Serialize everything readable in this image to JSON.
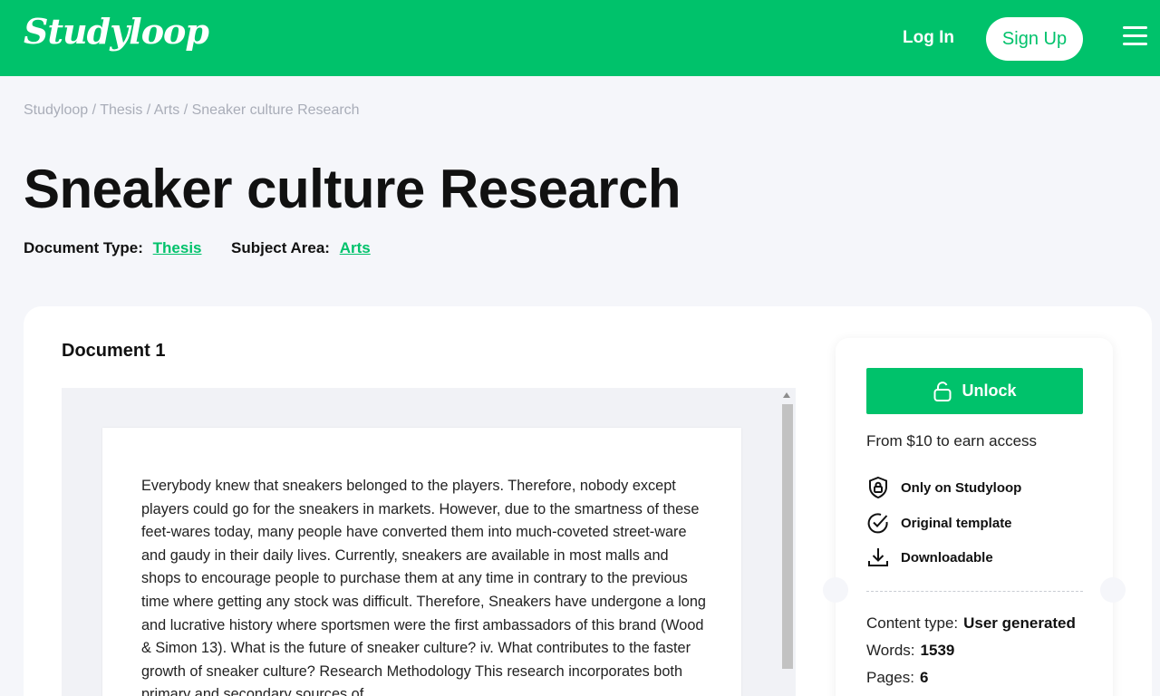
{
  "header": {
    "logo": "Studyloop",
    "login": "Log In",
    "signup": "Sign Up"
  },
  "breadcrumb": [
    "Studyloop",
    "Thesis",
    "Arts",
    "Sneaker culture Research"
  ],
  "title": "Sneaker culture Research",
  "meta": {
    "doc_type_label": "Document Type:",
    "doc_type_value": "Thesis",
    "subject_label": "Subject Area:",
    "subject_value": "Arts"
  },
  "document": {
    "label": "Document 1",
    "text": "Everybody knew that sneakers belonged to the players. Therefore, nobody except players could go for the sneakers in markets. However, due to the smartness of these feet-wares today, many people have converted them into much-coveted street-ware and gaudy in their daily lives. Currently, sneakers are available in most malls and shops to encourage people to purchase them at any time in contrary to the previous time where getting any stock was difficult. Therefore, Sneakers have undergone a long and lucrative history where sportsmen were the first ambassadors of this brand (Wood & Simon 13). What is the future of sneaker culture? iv. What contributes to the faster growth of sneaker culture? Research Methodology This research incorporates both primary and secondary sources of"
  },
  "sidebar": {
    "unlock_label": "Unlock",
    "price_text": "From $10 to earn access",
    "features": [
      "Only on Studyloop",
      "Original template",
      "Downloadable"
    ],
    "content_type_label": "Content type:",
    "content_type_value": "User generated",
    "words_label": "Words:",
    "words_value": "1539",
    "pages_label": "Pages:",
    "pages_value": "6"
  },
  "colors": {
    "brand": "#00c26b",
    "background": "#f5f6fa"
  }
}
